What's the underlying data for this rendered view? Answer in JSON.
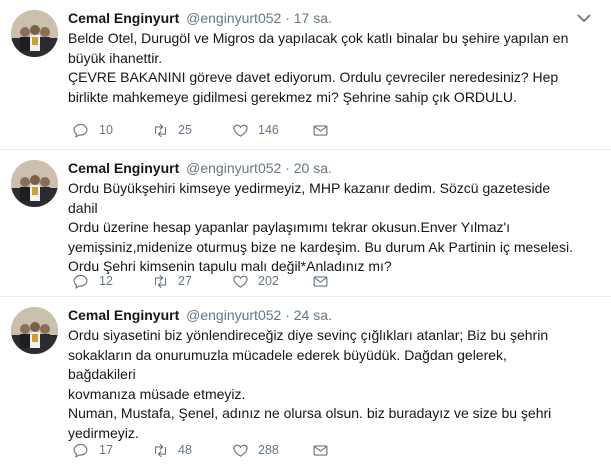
{
  "tweets": [
    {
      "name": "Cemal Enginyurt",
      "handle": "@enginyurt052",
      "dot": "·",
      "time": "17 sa.",
      "text": "Belde Otel, Durugöl ve Migros da yapılacak çok katlı binalar bu şehire yapılan en\nbüyük ihanettir.\nÇEVRE BAKANINI göreve davet ediyorum. Ordulu çevreciler neredesiniz? Hep\nbirlikte mahkemeye gidilmesi gerekmez mi? Şehrine sahip çık ORDULU.",
      "replies": "10",
      "retweets": "25",
      "likes": "146"
    },
    {
      "name": "Cemal Enginyurt",
      "handle": "@enginyurt052",
      "dot": "·",
      "time": "20 sa.",
      "text": "Ordu Büyükşehiri kimseye yedirmeyiz, MHP kazanır dedim. Sözcü gazeteside dahil\nOrdu üzerine hesap yapanlar paylaşımımı tekrar okusun.Enver Yılmaz'ı\nyemişsiniz,midenize oturmuş bize ne kardeşim. Bu durum Ak Partinin iç meselesi.\nOrdu Şehri kimsenin tapulu malı değil*Anladınız mı?",
      "replies": "12",
      "retweets": "27",
      "likes": "202"
    },
    {
      "name": "Cemal Enginyurt",
      "handle": "@enginyurt052",
      "dot": "·",
      "time": "24 sa.",
      "text": "Ordu siyasetini biz yönlendireceğiz diye sevinç çığlıkları atanlar; Biz bu şehrin\nsokakların da onurumuzla mücadele ederek büyüdük. Dağdan gelerek, bağdakileri\nkovmanıza müsade etmeyiz.\nNuman, Mustafa, Şenel, adınız ne olursa olsun. biz buradayız ve size bu şehri\nyedirmeyiz.",
      "replies": "17",
      "retweets": "48",
      "likes": "288"
    }
  ],
  "icons": {
    "reply": "reply-icon",
    "retweet": "retweet-icon",
    "like": "heart-icon",
    "dm": "envelope-icon",
    "menu": "chevron-down-icon"
  }
}
